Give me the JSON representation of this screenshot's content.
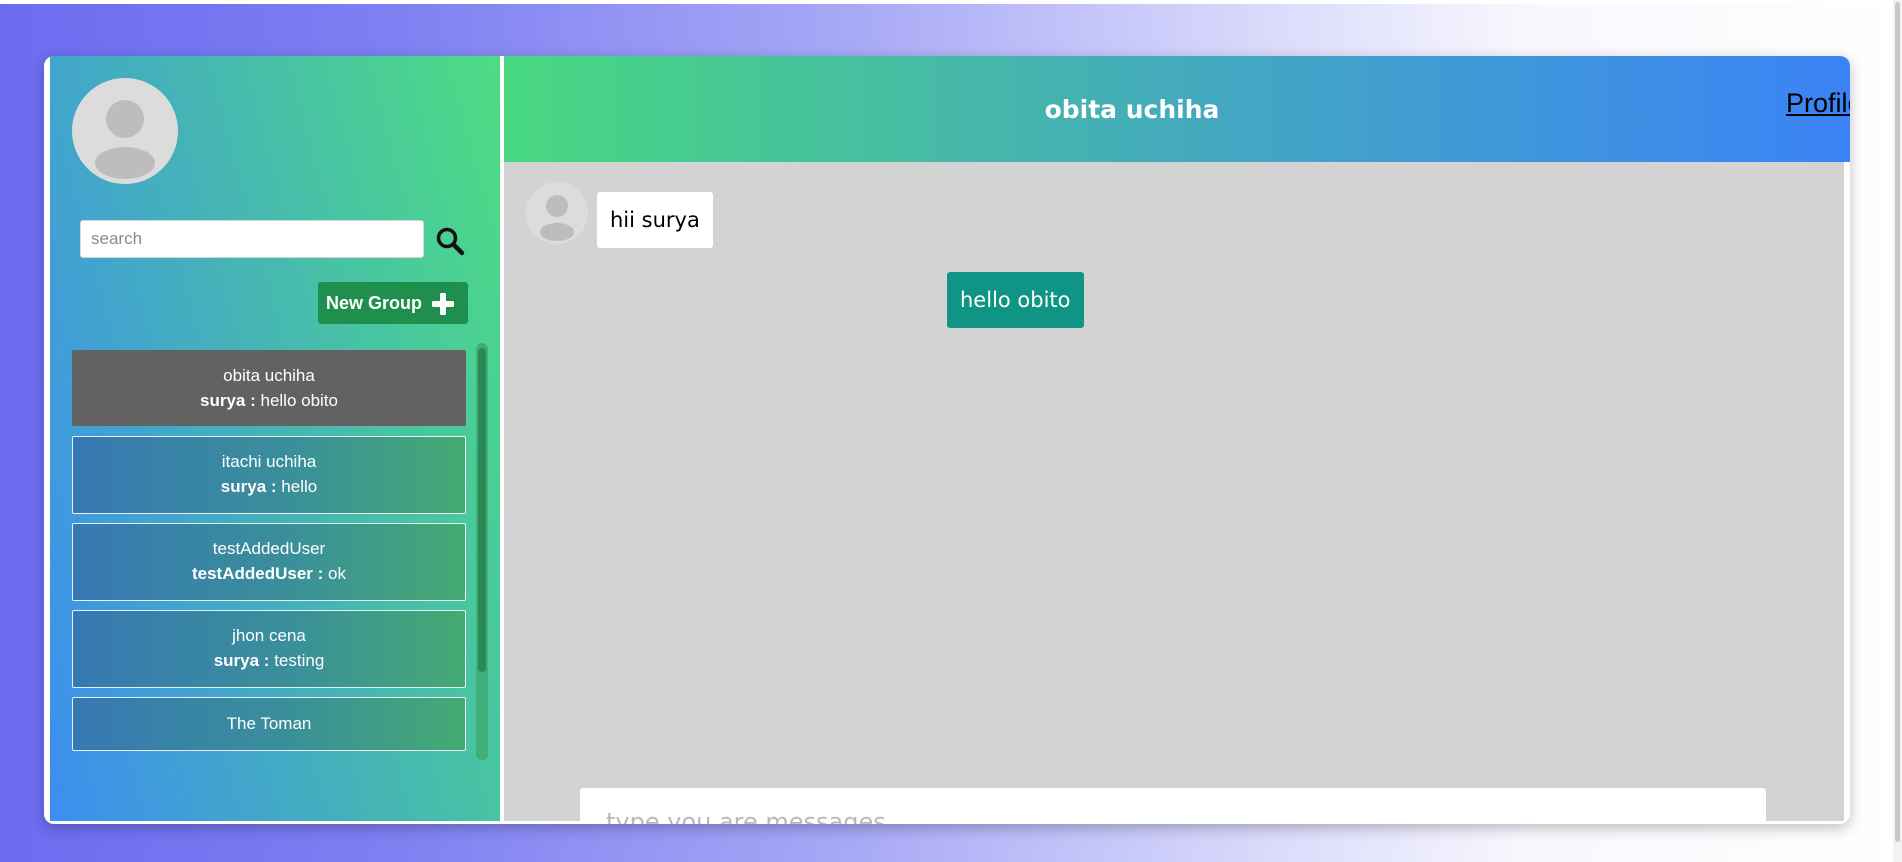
{
  "sidebar": {
    "search": {
      "placeholder": "search",
      "value": ""
    },
    "new_group_label": "New Group",
    "chats": [
      {
        "name": "obita uchiha",
        "sender": "surya :",
        "message": "hello obito",
        "active": true
      },
      {
        "name": "itachi uchiha",
        "sender": "surya :",
        "message": "hello",
        "active": false
      },
      {
        "name": "testAddedUser",
        "sender": "testAddedUser :",
        "message": "ok",
        "active": false
      },
      {
        "name": "jhon cena",
        "sender": "surya :",
        "message": "testing",
        "active": false
      },
      {
        "name": "The Toman",
        "sender": "",
        "message": "",
        "active": false
      }
    ]
  },
  "header": {
    "title": "obita uchiha",
    "profile_label": "Profile"
  },
  "messages": [
    {
      "text": "hii surya",
      "direction": "incoming"
    },
    {
      "text": "hello obito",
      "direction": "outgoing"
    }
  ],
  "composer": {
    "placeholder": "type you are messages",
    "value": ""
  },
  "colors": {
    "active_chat": "#626262",
    "new_group_button": "#1f8f4e",
    "outgoing_bubble": "#0f9486",
    "chat_area": "#d3d3d3"
  },
  "icons": {
    "search": "search-icon",
    "plus": "plus-icon",
    "avatar": "avatar-icon"
  }
}
